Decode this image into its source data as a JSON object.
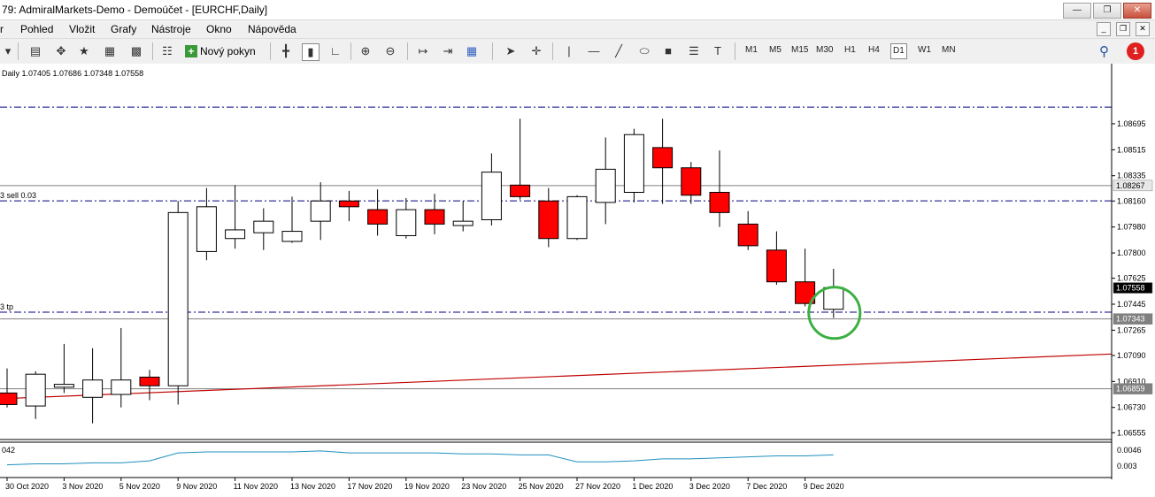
{
  "window": {
    "title": "79: AdmiralMarkets-Demo - Demoúčet - [EURCHF,Daily]"
  },
  "menu": {
    "items": [
      "r",
      "Pohled",
      "Vložit",
      "Grafy",
      "Nástroje",
      "Okno",
      "Nápověda"
    ]
  },
  "toolbar": {
    "new_order_label": "Nový pokyn",
    "timeframes": [
      "M1",
      "M5",
      "M15",
      "M30",
      "H1",
      "H4",
      "D1",
      "W1",
      "MN"
    ],
    "active_timeframe": "D1",
    "alerts_count": "1"
  },
  "chart_info": {
    "header": "Daily  1.07405 1.07686 1.07348 1.07558"
  },
  "chart_data": {
    "type": "candlestick",
    "symbol": "EURCHF",
    "period": "Daily",
    "y_range": [
      1.0652,
      1.0905
    ],
    "y_ticks": [
      "1.08695",
      "1.08515",
      "1.08335",
      "1.08160",
      "1.07980",
      "1.07800",
      "1.07625",
      "1.07445",
      "1.07265",
      "1.07090",
      "1.06910",
      "1.06730",
      "1.06555"
    ],
    "x_labels": [
      "30 Oct 2020",
      "3 Nov 2020",
      "5 Nov 2020",
      "9 Nov 2020",
      "11 Nov 2020",
      "13 Nov 2020",
      "17 Nov 2020",
      "19 Nov 2020",
      "23 Nov 2020",
      "25 Nov 2020",
      "27 Nov 2020",
      "1 Dec 2020",
      "3 Dec 2020",
      "7 Dec 2020",
      "9 Dec 2020"
    ],
    "candles": [
      {
        "o": 1.0683,
        "h": 1.07,
        "l": 1.0673,
        "c": 1.0675
      },
      {
        "o": 1.0674,
        "h": 1.0698,
        "l": 1.0665,
        "c": 1.0696
      },
      {
        "o": 1.0687,
        "h": 1.0717,
        "l": 1.0683,
        "c": 1.0689
      },
      {
        "o": 1.068,
        "h": 1.0714,
        "l": 1.0662,
        "c": 1.0692
      },
      {
        "o": 1.0682,
        "h": 1.0728,
        "l": 1.0673,
        "c": 1.0692
      },
      {
        "o": 1.0694,
        "h": 1.0699,
        "l": 1.0678,
        "c": 1.0688
      },
      {
        "o": 1.0688,
        "h": 1.0816,
        "l": 1.0675,
        "c": 1.0808
      },
      {
        "o": 1.0781,
        "h": 1.0825,
        "l": 1.0775,
        "c": 1.0812
      },
      {
        "o": 1.079,
        "h": 1.0827,
        "l": 1.0783,
        "c": 1.0796
      },
      {
        "o": 1.0794,
        "h": 1.0811,
        "l": 1.0782,
        "c": 1.0802
      },
      {
        "o": 1.0788,
        "h": 1.0819,
        "l": 1.0787,
        "c": 1.0795
      },
      {
        "o": 1.0802,
        "h": 1.0829,
        "l": 1.0789,
        "c": 1.0816
      },
      {
        "o": 1.0816,
        "h": 1.0823,
        "l": 1.0802,
        "c": 1.0812
      },
      {
        "o": 1.081,
        "h": 1.0824,
        "l": 1.0792,
        "c": 1.08
      },
      {
        "o": 1.0792,
        "h": 1.0818,
        "l": 1.079,
        "c": 1.081
      },
      {
        "o": 1.081,
        "h": 1.0821,
        "l": 1.0793,
        "c": 1.08
      },
      {
        "o": 1.0799,
        "h": 1.0816,
        "l": 1.0795,
        "c": 1.0802
      },
      {
        "o": 1.0803,
        "h": 1.0849,
        "l": 1.0799,
        "c": 1.0836
      },
      {
        "o": 1.0827,
        "h": 1.0873,
        "l": 1.0817,
        "c": 1.0819
      },
      {
        "o": 1.0816,
        "h": 1.0825,
        "l": 1.0784,
        "c": 1.079
      },
      {
        "o": 1.079,
        "h": 1.082,
        "l": 1.0789,
        "c": 1.0819
      },
      {
        "o": 1.0815,
        "h": 1.086,
        "l": 1.08,
        "c": 1.0838
      },
      {
        "o": 1.0822,
        "h": 1.0866,
        "l": 1.0815,
        "c": 1.0862
      },
      {
        "o": 1.0853,
        "h": 1.0873,
        "l": 1.0814,
        "c": 1.0839
      },
      {
        "o": 1.0839,
        "h": 1.0843,
        "l": 1.0814,
        "c": 1.082
      },
      {
        "o": 1.0822,
        "h": 1.0851,
        "l": 1.0798,
        "c": 1.0808
      },
      {
        "o": 1.08,
        "h": 1.0809,
        "l": 1.0782,
        "c": 1.0785
      },
      {
        "o": 1.0782,
        "h": 1.0795,
        "l": 1.0758,
        "c": 1.076
      },
      {
        "o": 1.076,
        "h": 1.0783,
        "l": 1.0743,
        "c": 1.0745
      },
      {
        "o": 1.0741,
        "h": 1.0769,
        "l": 1.0735,
        "c": 1.0756
      }
    ],
    "levels": [
      {
        "price": 1.0881,
        "style": "dashdot",
        "color": "#000080",
        "label": "Daily  1.07405 1.07686 1.07348 1.07558"
      },
      {
        "price": 1.08161,
        "style": "dashdot",
        "color": "#000080",
        "label": "3 sell 0.03"
      },
      {
        "price": 1.0739,
        "style": "dashdot",
        "color": "#000080",
        "label": "3 tp"
      },
      {
        "price": 1.08267,
        "style": "solid",
        "color": "#808080",
        "label": ""
      },
      {
        "price": 1.07343,
        "style": "solid",
        "color": "#808080",
        "label": ""
      },
      {
        "price": 1.06859,
        "style": "solid",
        "color": "#808080",
        "label": ""
      }
    ],
    "price_boxes": [
      {
        "price": 1.08267,
        "label": "1.08267",
        "bg": "#e8e8e8",
        "fg": "#000"
      },
      {
        "price": 1.07558,
        "label": "1.07558",
        "bg": "#000",
        "fg": "#fff"
      },
      {
        "price": 1.07343,
        "label": "1.07343",
        "bg": "#808080",
        "fg": "#fff"
      },
      {
        "price": 1.06859,
        "label": "1.06859",
        "bg": "#808080",
        "fg": "#fff"
      }
    ],
    "trendline": {
      "from_price": 1.0679,
      "to_price": 1.071,
      "color": "#c00000"
    },
    "highlight_circle_color": "#3cb043",
    "indicator": {
      "label": "042",
      "y_ticks": [
        "0.0046",
        "0.003"
      ],
      "y_range": [
        0.002,
        0.0052
      ],
      "values": [
        0.0031,
        0.0032,
        0.0032,
        0.0033,
        0.0033,
        0.0035,
        0.0043,
        0.0044,
        0.0044,
        0.0044,
        0.0044,
        0.0045,
        0.0043,
        0.0043,
        0.0043,
        0.0043,
        0.0042,
        0.0042,
        0.0041,
        0.0041,
        0.0034,
        0.0034,
        0.0035,
        0.0037,
        0.0037,
        0.0038,
        0.0039,
        0.004,
        0.004,
        0.0041
      ],
      "color": "#1f8fbf"
    },
    "colors": {
      "bull_fill": "#ffffff",
      "bear_fill": "#ff0000",
      "outline": "#000000"
    }
  }
}
